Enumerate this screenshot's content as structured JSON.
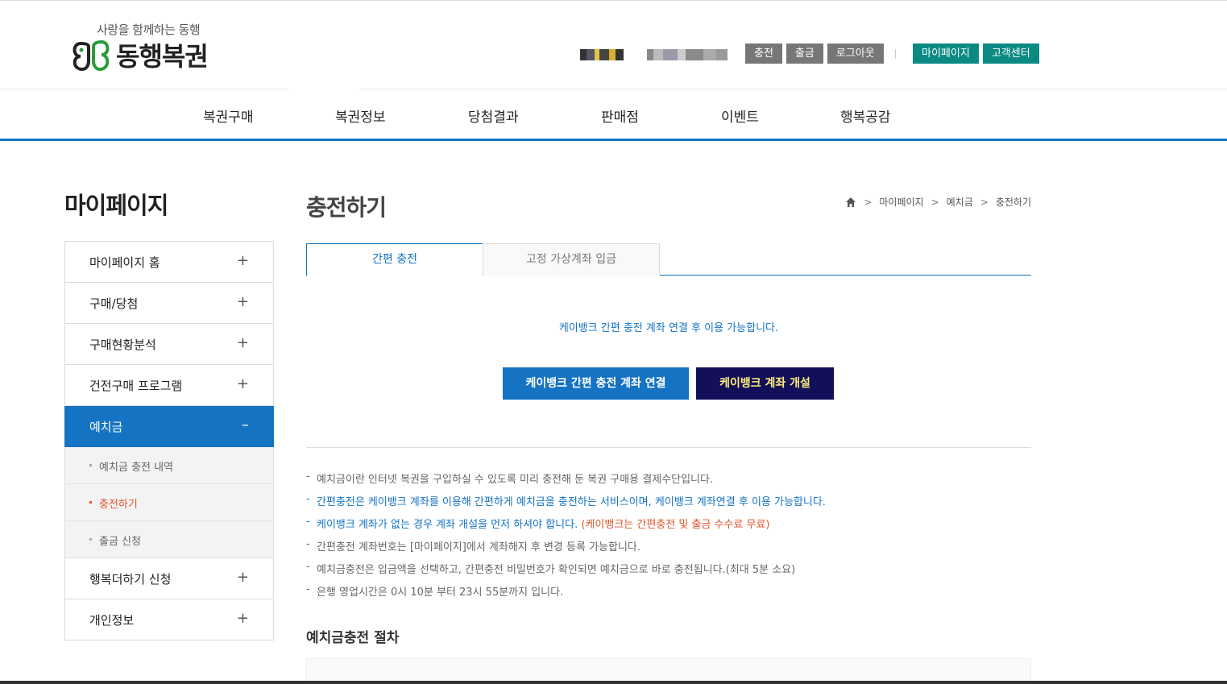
{
  "header": {
    "slogan": "사랑을 함께하는 동행",
    "brand": "동행복권",
    "util": {
      "charge": "충전",
      "withdraw": "출금",
      "logout": "로그아웃",
      "mypage": "마이페이지",
      "customer_center": "고객센터"
    },
    "colors": {
      "util_gray": "#777777",
      "util_teal": "#0a8a83"
    }
  },
  "gnb": {
    "items": [
      "복권구매",
      "복권정보",
      "당첨결과",
      "판매점",
      "이벤트",
      "행복공감"
    ],
    "accent": "#1473c3"
  },
  "lnb": {
    "title": "마이페이지",
    "items": [
      {
        "label": "마이페이지 홈",
        "icon": "+"
      },
      {
        "label": "구매/당첨",
        "icon": "+"
      },
      {
        "label": "구매현황분석",
        "icon": "+"
      },
      {
        "label": "건전구매 프로그램",
        "icon": "+"
      },
      {
        "label": "예치금",
        "icon": "–"
      },
      {
        "label": "행복더하기 신청",
        "icon": "+"
      },
      {
        "label": "개인정보",
        "icon": "+"
      }
    ],
    "sub": [
      "예치금 충전 내역",
      "충전하기",
      "출금 신청"
    ]
  },
  "content": {
    "title": "충전하기",
    "breadcrumb": [
      "마이페이지",
      "예치금",
      "충전하기"
    ],
    "tabs": [
      "간편 충전",
      "고정 가상계좌 입금"
    ],
    "notice": "케이뱅크 간편 충전 계좌 연결 후 이용 가능합니다.",
    "buttons": {
      "link": "케이뱅크 간편 충전 계좌 연결",
      "open": "케이뱅크 계좌 개설"
    },
    "info": [
      "예치금이란 인터넷 복권을 구입하실 수 있도록 미리 충전해 둔 복권 구매용 결제수단입니다.",
      "간편충전은 케이뱅크 계좌를 이용해 간편하게 예치금을 충전하는 서비스이며, 케이뱅크 계좌연결 후 이용 가능합니다.",
      "케이뱅크 계좌가 없는 경우 계좌 개설을 먼저 하셔야 합니다.",
      "(케이뱅크는 간편충전 및 출금 수수료 무료)",
      "간편충전 계좌번호는 [마이페이지]에서 계좌해지 후 변경 등록 가능합니다.",
      "예치금충전은 입금액을 선택하고, 간편충전 비밀번호가 확인되면 예치금으로 바로 충전됩니다.(최대 5분 소요)",
      "은행 영업시간은 0시 10분 부터 23시 55분까지 입니다."
    ],
    "section_title": "예치금충전 절차",
    "dash": "-"
  }
}
